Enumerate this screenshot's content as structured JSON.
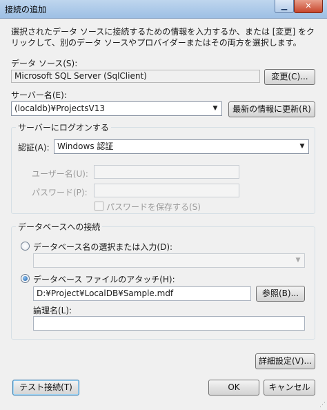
{
  "window": {
    "title": "接続の追加",
    "minimize_glyph": "▁",
    "close_glyph": "✕"
  },
  "description": "選択されたデータ ソースに接続するための情報を入力するか、または [変更] をクリックして、別のデータ ソースやプロバイダーまたはその両方を選択します。",
  "data_source": {
    "label": "データ ソース(S):",
    "value": "Microsoft SQL Server (SqlClient)",
    "change_button": "変更(C)..."
  },
  "server": {
    "label": "サーバー名(E):",
    "value": "(localdb)¥ProjectsV13",
    "refresh_button": "最新の情報に更新(R)"
  },
  "logon": {
    "group_title": "サーバーにログオンする",
    "auth_label": "認証(A):",
    "auth_value": "Windows 認証",
    "username_label": "ユーザー名(U):",
    "username_value": "",
    "password_label": "パスワード(P):",
    "password_value": "",
    "save_password_label": "パスワードを保存する(S)",
    "save_password_checked": false
  },
  "database": {
    "group_title": "データベースへの接続",
    "select_option_label": "データベース名の選択または入力(D):",
    "select_option_selected": false,
    "select_value": "",
    "attach_option_label": "データベース ファイルのアタッチ(H):",
    "attach_option_selected": true,
    "file_path": "D:¥Project¥LocalDB¥Sample.mdf",
    "browse_button": "参照(B)...",
    "logical_name_label": "論理名(L):",
    "logical_name_value": ""
  },
  "advanced_button": "詳細設定(V)...",
  "footer": {
    "test_button": "テスト接続(T)",
    "ok_button": "OK",
    "cancel_button": "キャンセル"
  },
  "icons": {
    "dropdown": "chevron-down-icon",
    "resize": "resize-grip-icon"
  },
  "colors": {
    "dialog_bg": "#f0f0f0",
    "titlebar": "#9dbfe4",
    "default_button_border": "#3c7fb1",
    "radio_dot": "#1e5fa8"
  }
}
